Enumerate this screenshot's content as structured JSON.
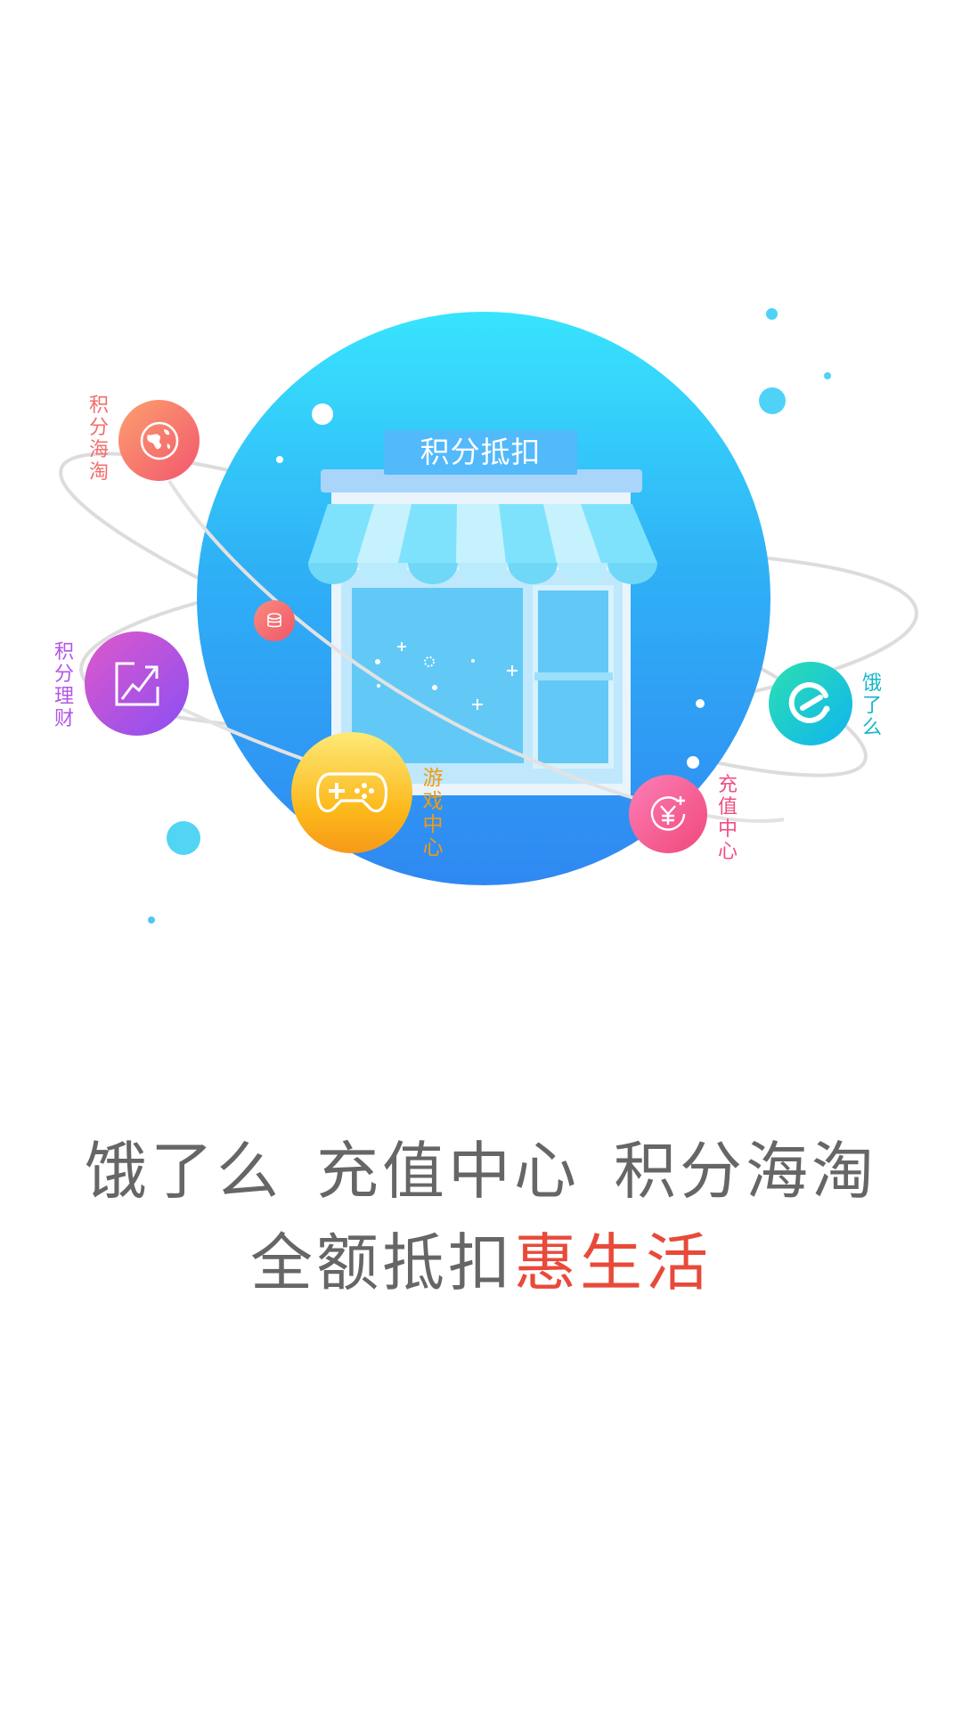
{
  "hero": {
    "shop_sign": "积分抵扣",
    "orbit_items": [
      {
        "key": "haitao",
        "label": "积分海淘",
        "icon": "globe-icon",
        "color": "#f06a6a"
      },
      {
        "key": "licai",
        "label": "积分理财",
        "icon": "trend-up-icon",
        "color": "#b356e6"
      },
      {
        "key": "youxi",
        "label": "游戏中心",
        "icon": "gamepad-icon",
        "color": "#f39a12"
      },
      {
        "key": "chongzhi",
        "label": "充值中心",
        "icon": "yen-plus-icon",
        "color": "#f04f86"
      },
      {
        "key": "eleme",
        "label": "饿了么",
        "icon": "eleme-logo-icon",
        "color": "#19c7c0"
      }
    ]
  },
  "tagline": {
    "line1": [
      "饿了么",
      "充值中心",
      "积分海淘"
    ],
    "line2_prefix": "全额抵扣",
    "line2_highlight": "惠生活"
  },
  "colors": {
    "accent_red": "#e84a3a",
    "circle_top": "#38e4fd",
    "circle_bottom": "#2f88f2",
    "text_gray": "#666666"
  }
}
